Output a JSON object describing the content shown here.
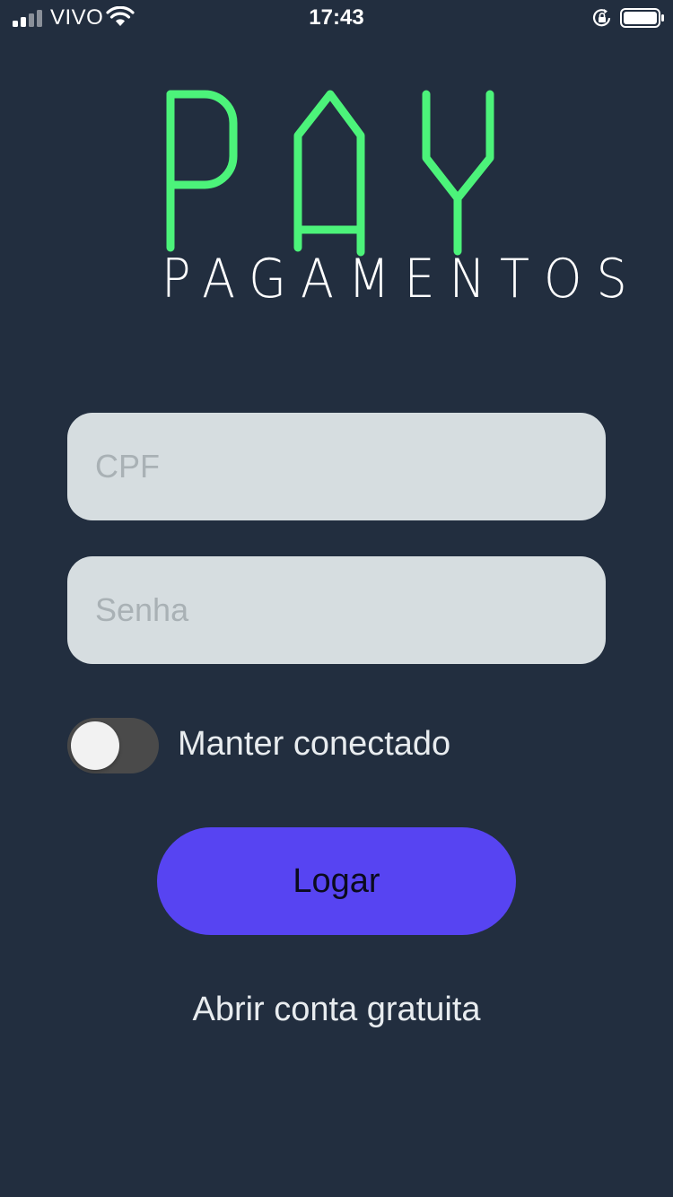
{
  "status_bar": {
    "carrier": "VIVO",
    "time": "17:43",
    "icons": [
      "signal-icon",
      "wifi-icon",
      "rotation-lock-icon",
      "battery-icon"
    ]
  },
  "logo": {
    "title": "PAY",
    "subtitle": "PAGAMENTOS",
    "colors": {
      "title": "#4cf37a",
      "subtitle": "#ffffff"
    }
  },
  "form": {
    "cpf_placeholder": "CPF",
    "password_placeholder": "Senha",
    "keep_connected_label": "Manter conectado",
    "keep_connected_on": false,
    "login_label": "Logar",
    "open_account_label": "Abrir conta gratuita"
  },
  "colors": {
    "background": "#222e3f",
    "input_background": "#d6dde0",
    "primary_button": "#5744f2",
    "accent_green": "#4cf37a"
  }
}
